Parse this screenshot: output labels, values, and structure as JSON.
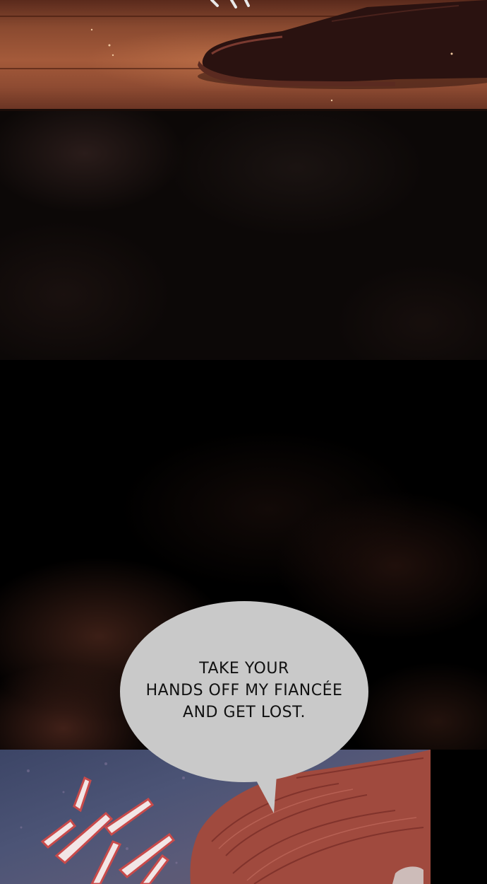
{
  "speech_bubble": {
    "lines": [
      "TAKE YOUR",
      "HANDS OFF MY FIANCÉE",
      "AND GET LOST."
    ]
  },
  "colors": {
    "floor": "#a45a3a",
    "shoe": "#2a1210",
    "bubble": "#c9c9c9",
    "background": "#000000",
    "hair": "#a04a3e",
    "bottom_panel": "#4c5476"
  }
}
